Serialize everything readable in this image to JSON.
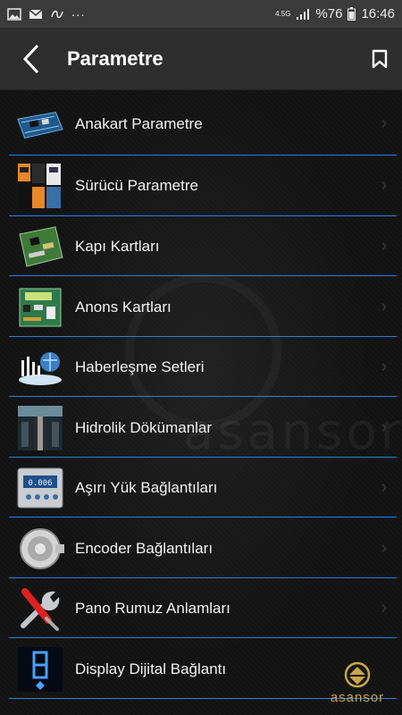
{
  "status_bar": {
    "network": "4.5G",
    "network_sub": "",
    "battery": "%76",
    "time": "16:46",
    "more": "..."
  },
  "app_bar": {
    "title": "Parametre"
  },
  "items": [
    {
      "label": "Anakart Parametre",
      "icon": "motherboard-icon"
    },
    {
      "label": "Sürücü Parametre",
      "icon": "drive-inverter-icon"
    },
    {
      "label": "Kapı Kartları",
      "icon": "door-card-icon"
    },
    {
      "label": "Anons Kartları",
      "icon": "announcement-card-icon"
    },
    {
      "label": "Haberleşme Setleri",
      "icon": "communication-set-icon"
    },
    {
      "label": "Hidrolik Dökümanlar",
      "icon": "hydraulic-docs-icon"
    },
    {
      "label": "Aşırı Yük Bağlantıları",
      "icon": "overload-scale-icon"
    },
    {
      "label": "Encoder Bağlantıları",
      "icon": "encoder-icon"
    },
    {
      "label": "Pano Rumuz Anlamları",
      "icon": "tools-icon"
    },
    {
      "label": "Display Dijital Bağlantı",
      "icon": "digital-display-icon"
    }
  ],
  "brand": {
    "name": "asansor",
    "accent": "#c8a64a"
  },
  "colors": {
    "divider": "#2b7fd6",
    "app_bar": "#2e2e2e",
    "status_bar": "#3b3b3b"
  }
}
